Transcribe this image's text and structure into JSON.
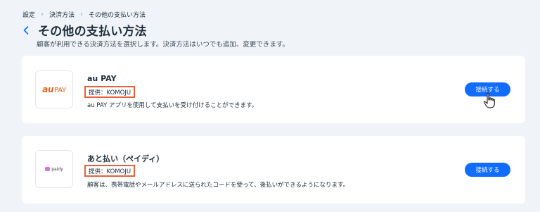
{
  "breadcrumb": {
    "items": [
      "設定",
      "決済方法",
      "その他の支払い方法"
    ],
    "separator": "›"
  },
  "header": {
    "back_icon": "chevron-left-icon",
    "title": "その他の支払い方法",
    "subtitle": "顧客が利用できる決済方法を選択します。決済方法はいつでも追加、変更できます。"
  },
  "methods": [
    {
      "logo_text": "au",
      "logo_text2": "PAY",
      "logo_color": "#e8611a",
      "name": "au PAY",
      "provider": "提供：KOMOJU",
      "description": "au PAY アプリを使用して支払いを受け付けることができます。",
      "button_label": "接続する"
    },
    {
      "logo_text": "paidy",
      "logo_color": "#c97ad6",
      "name": "あと払い（ペイディ）",
      "provider": "提供：KOMOJU",
      "description": "顧客は、携帯電話やメールアドレスに送られたコードを使って、後払いができるようになります。",
      "button_label": "接続する"
    }
  ],
  "colors": {
    "accent": "#116dff",
    "highlight": "#e4613a",
    "background": "#f0f4f8"
  }
}
